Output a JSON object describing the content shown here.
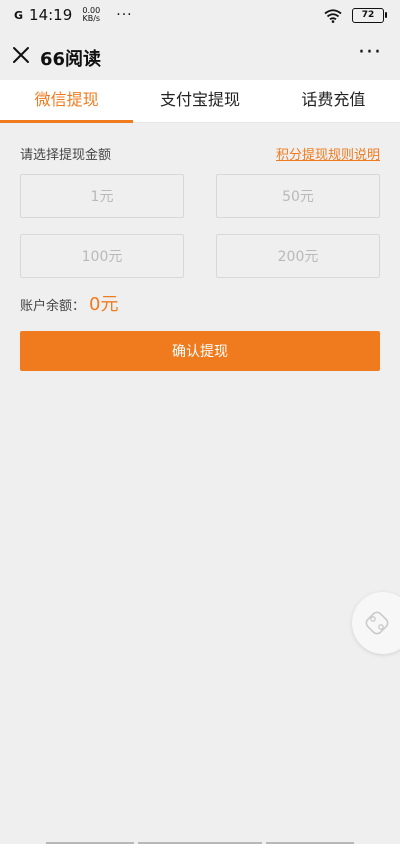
{
  "status_bar": {
    "signal": "G",
    "time": "14:19",
    "net_speed_value": "0.00",
    "net_speed_unit": "KB/s",
    "dots": "···",
    "battery": "72"
  },
  "title_bar": {
    "title": "66阅读",
    "more": "···"
  },
  "tabs": [
    {
      "label": "微信提现",
      "active": true
    },
    {
      "label": "支付宝提现",
      "active": false
    },
    {
      "label": "话费充值",
      "active": false
    }
  ],
  "withdraw": {
    "select_label": "请选择提现金额",
    "rules_link": "积分提现规则说明",
    "amounts": [
      "1元",
      "50元",
      "100元",
      "200元"
    ],
    "balance_label": "账户余额：",
    "balance_value": "0元",
    "confirm_label": "确认提现"
  },
  "colors": {
    "accent": "#f07b1f",
    "background": "#efefef"
  },
  "icons": {
    "close": "close-icon",
    "more": "more-icon",
    "wifi": "wifi-icon",
    "battery": "battery-icon",
    "float": "floating-ball-icon"
  }
}
